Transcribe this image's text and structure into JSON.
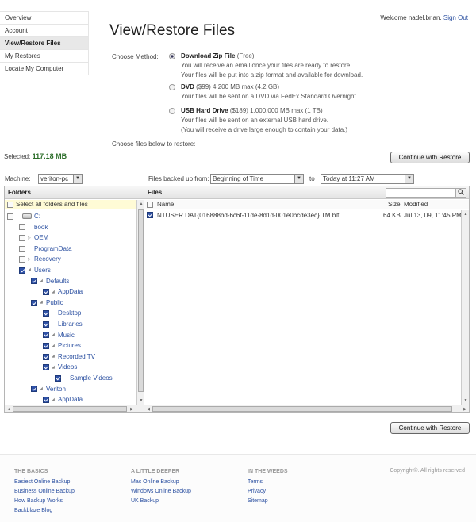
{
  "sidebar": {
    "items": [
      "Overview",
      "Account",
      "View/Restore Files",
      "My Restores",
      "Locate My Computer"
    ]
  },
  "header": {
    "welcome_prefix": "Welcome",
    "username": "nadel.brian.",
    "signout": "Sign Out"
  },
  "page_title": "View/Restore Files",
  "choose_method_label": "Choose Method:",
  "methods": [
    {
      "name": "Download Zip File",
      "price": "(Free)",
      "lines": [
        "You will receive an email once your files are ready to restore.",
        "Your files will be put into a zip format and available for download."
      ],
      "selected": true
    },
    {
      "name": "DVD",
      "price": "($99) 4,200 MB max (4.2 GB)",
      "lines": [
        "Your files will be sent on a DVD via FedEx Standard Overnight."
      ],
      "selected": false
    },
    {
      "name": "USB Hard Drive",
      "price": "($189) 1,000,000 MB max (1 TB)",
      "lines": [
        "Your files will be sent on an external USB hard drive.",
        "(You will receive a drive large enough to contain your data.)"
      ],
      "selected": false
    }
  ],
  "choose_files_label": "Choose files below to restore:",
  "selected_label": "Selected:",
  "selected_value": "117.18 MB",
  "continue_label": "Continue with Restore",
  "machine_label": "Machine:",
  "machine_value": "veriton-pc",
  "backed_up_label": "Files backed up from:",
  "backed_from": "Beginning of Time",
  "to_label": "to",
  "backed_to": "Today at 11:27 AM",
  "folders_head": "Folders",
  "files_head": "Files",
  "select_all": "Select all folders and files",
  "tree": [
    {
      "label": "C:",
      "indent": 0,
      "checked": false,
      "kind": "drive"
    },
    {
      "label": "book",
      "indent": 1,
      "checked": false,
      "kind": "folder"
    },
    {
      "label": "OEM",
      "indent": 1,
      "checked": false,
      "kind": "folder",
      "expander": true
    },
    {
      "label": "ProgramData",
      "indent": 1,
      "checked": false,
      "kind": "folder"
    },
    {
      "label": "Recovery",
      "indent": 1,
      "checked": false,
      "kind": "folder",
      "expander": true
    },
    {
      "label": "Users",
      "indent": 1,
      "checked": true,
      "kind": "folder",
      "expander": true
    },
    {
      "label": "Defaults",
      "indent": 2,
      "checked": true,
      "kind": "folder",
      "expander": true
    },
    {
      "label": "AppData",
      "indent": 3,
      "checked": true,
      "kind": "folder",
      "expander": true
    },
    {
      "label": "Public",
      "indent": 2,
      "checked": true,
      "kind": "folder",
      "expander": true
    },
    {
      "label": "Desktop",
      "indent": 3,
      "checked": true,
      "kind": "folder"
    },
    {
      "label": "Libraries",
      "indent": 3,
      "checked": true,
      "kind": "folder"
    },
    {
      "label": "Music",
      "indent": 3,
      "checked": true,
      "kind": "folder",
      "expander": true
    },
    {
      "label": "Pictures",
      "indent": 3,
      "checked": true,
      "kind": "folder",
      "expander": true
    },
    {
      "label": "Recorded TV",
      "indent": 3,
      "checked": true,
      "kind": "folder",
      "expander": true
    },
    {
      "label": "Videos",
      "indent": 3,
      "checked": true,
      "kind": "folder",
      "expander": true
    },
    {
      "label": "Sample Videos",
      "indent": 4,
      "checked": true,
      "kind": "folder"
    },
    {
      "label": "Veriton",
      "indent": 2,
      "checked": true,
      "kind": "folder",
      "expander": true
    },
    {
      "label": "AppData",
      "indent": 3,
      "checked": true,
      "kind": "folder",
      "expander": true
    }
  ],
  "files_columns": {
    "name": "Name",
    "size": "Size",
    "modified": "Modified"
  },
  "files": [
    {
      "name": "NTUSER.DAT{016888bd-6c6f-11de-8d1d-001e0bcde3ec}.TM.blf",
      "size": "64 KB",
      "modified": "Jul 13, 09, 11:45 PM",
      "checked": true
    }
  ],
  "footer": {
    "columns": [
      {
        "heading": "THE BASICS",
        "links": [
          "Easiest Online Backup",
          "Business Online Backup",
          "How Backup Works",
          "Backblaze Blog"
        ]
      },
      {
        "heading": "A LITTLE DEEPER",
        "links": [
          "Mac Online Backup",
          "Windows Online Backup",
          "UK Backup"
        ]
      },
      {
        "heading": "IN THE WEEDS",
        "links": [
          "Terms",
          "Privacy",
          "Sitemap"
        ]
      }
    ],
    "copyright": "Copyright©. All rights reserved"
  },
  "icons": {
    "search": "search-icon",
    "drive": "drive-icon"
  }
}
